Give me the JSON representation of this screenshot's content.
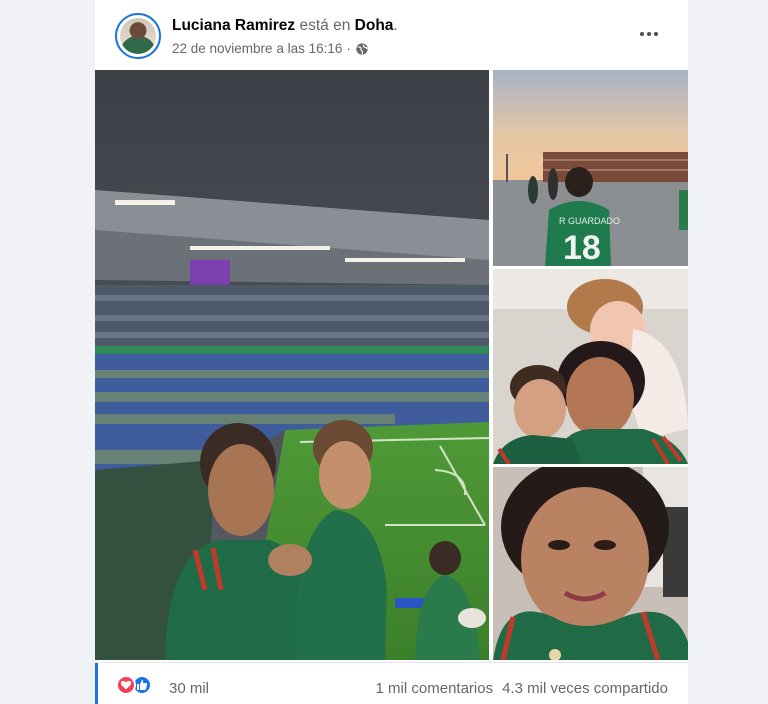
{
  "post": {
    "author": "Luciana Ramirez",
    "verb": "está en",
    "location": "Doha",
    "period": ".",
    "timestamp": "22 de noviembre a las 16:16",
    "separator": "·",
    "privacy_icon": "globe-icon",
    "more_icon": "more-options-icon"
  },
  "photos": [
    {
      "name": "stadium-selfie-photo",
      "subject": "mother and child in Mexico jerseys at stadium"
    },
    {
      "name": "stadium-exterior-photo",
      "subject": "child with jersey number 18 outside stadium"
    },
    {
      "name": "family-selfie-photo",
      "subject": "mother with two children"
    },
    {
      "name": "woman-selfie-photo",
      "subject": "woman selfie in Mexico jersey"
    }
  ],
  "jersey_text": {
    "name": "R GUARDADO",
    "number": "18"
  },
  "footer": {
    "reactions": [
      "love",
      "like"
    ],
    "reaction_count": "30 mil",
    "comments": "1 mil comentarios",
    "shares": "4.3 mil veces compartido"
  },
  "colors": {
    "accent": "#1b74e4",
    "love": "#f33e58",
    "secondary_text": "#65676b",
    "pitch_green": "#3f8a2f",
    "jersey_green": "#1f6b45"
  }
}
